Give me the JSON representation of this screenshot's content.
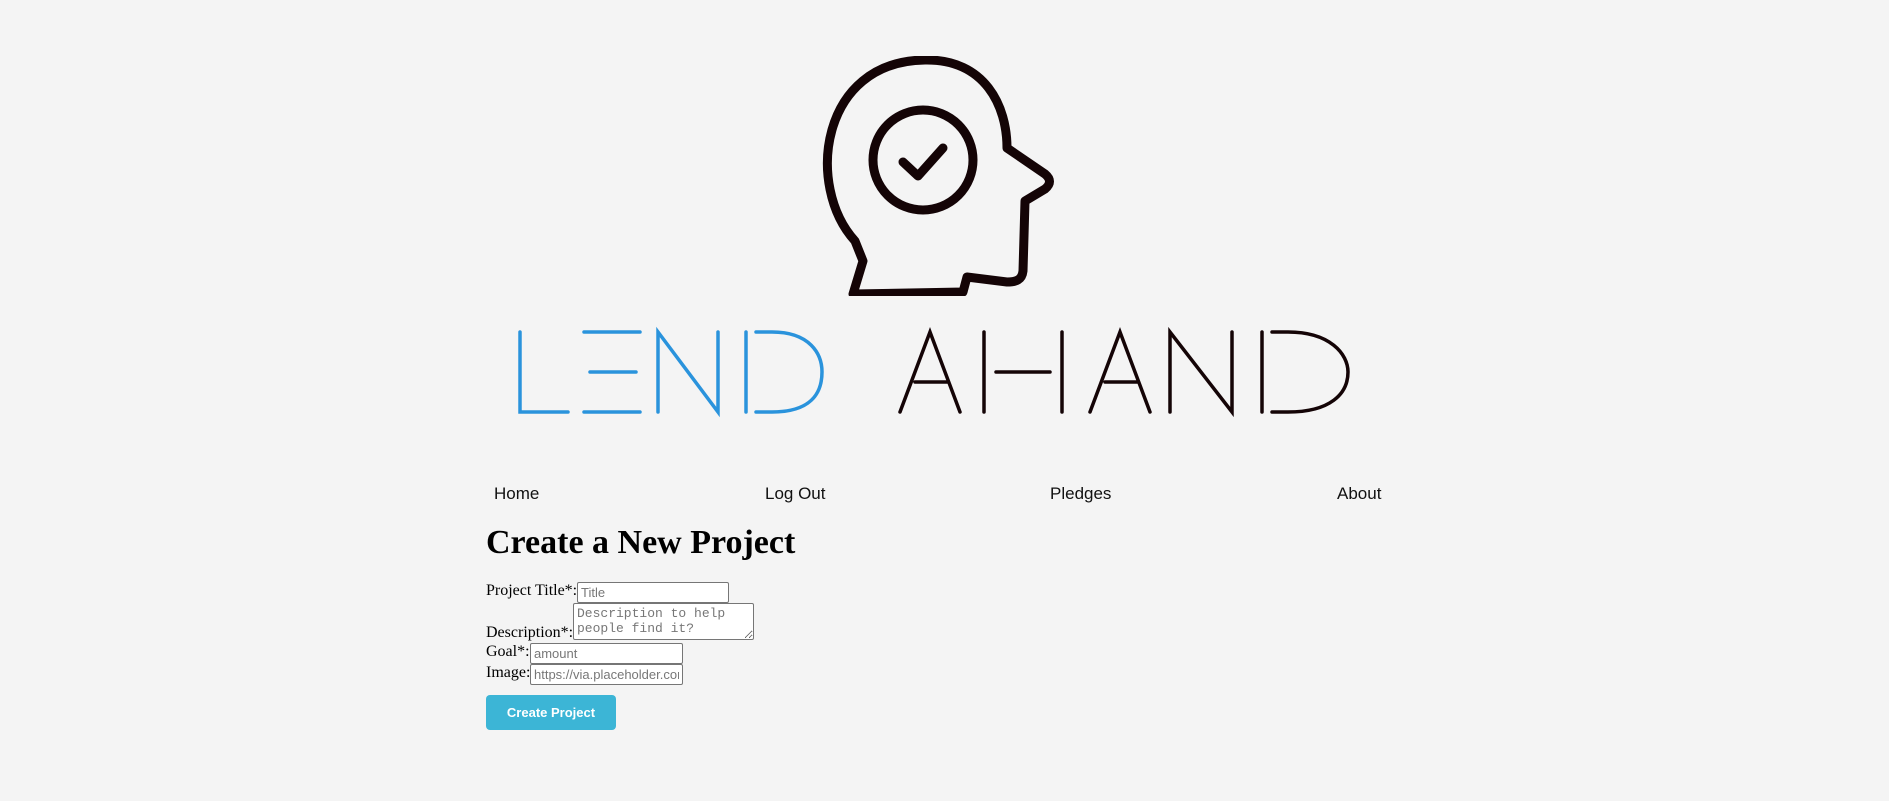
{
  "brand": {
    "wordmark_part1": "LEND",
    "wordmark_part2": "AHAND",
    "colors": {
      "accent": "#2a93dc",
      "dark": "#140406"
    },
    "icon": "head-checkmark-icon"
  },
  "nav": {
    "items": [
      {
        "label": "Home"
      },
      {
        "label": "Log Out"
      },
      {
        "label": "Pledges"
      },
      {
        "label": "About"
      }
    ]
  },
  "page": {
    "title": "Create a New Project"
  },
  "form": {
    "title_label": "Project Title*:",
    "title_placeholder": "Title",
    "description_label": "Description*:",
    "description_placeholder": "Description to help people find it?",
    "goal_label": "Goal*:",
    "goal_placeholder": "amount",
    "image_label": "Image:",
    "image_placeholder": "https://via.placeholder.com",
    "submit_label": "Create Project"
  },
  "colors": {
    "background": "#f4f4f4",
    "button": "#3cb5d6"
  }
}
